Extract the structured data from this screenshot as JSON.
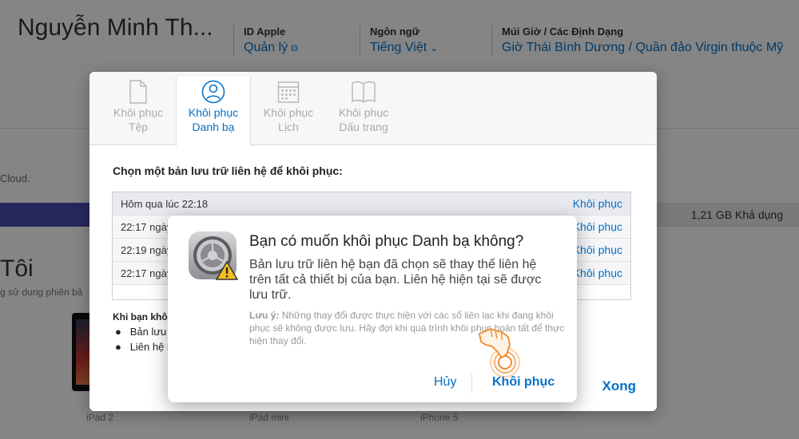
{
  "header": {
    "user_name": "Nguyễn Minh Th...",
    "apple_id": {
      "label": "ID Apple",
      "value": "Quản lý"
    },
    "language": {
      "label": "Ngôn ngữ",
      "value": "Tiếng Việt"
    },
    "timezone": {
      "label": "Múi Giờ / Các Định Dạng",
      "value": "Giờ Thái Bình Dương / Quần đảo Virgin thuộc Mỹ"
    }
  },
  "background": {
    "cloud_text": "Cloud.",
    "storage_available": "1,21 GB Khả dụng",
    "section_title": "Tôi",
    "section_subtitle": "g sử dụng phiên bả",
    "devices": [
      "iPad 2",
      "iPad mini",
      "iPhone 5"
    ]
  },
  "panel": {
    "tabs": [
      {
        "line1": "Khôi phục",
        "line2": "Tệp",
        "icon": "file-icon"
      },
      {
        "line1": "Khôi phục",
        "line2": "Danh bạ",
        "icon": "contacts-icon"
      },
      {
        "line1": "Khôi phục",
        "line2": "Lịch",
        "icon": "calendar-icon"
      },
      {
        "line1": "Khôi phục",
        "line2": "Dấu trang",
        "icon": "bookmarks-icon"
      }
    ],
    "heading": "Chọn một bản lưu trữ liên hệ để khôi phục:",
    "backups": [
      {
        "date": "Hôm qua lúc 22:18",
        "action": "Khôi phục"
      },
      {
        "date": "22:17 ngày",
        "action": "Khôi phục"
      },
      {
        "date": "22:19 ngày",
        "action": "Khôi phục"
      },
      {
        "date": "22:17 ngày",
        "action": "Khôi phục"
      }
    ],
    "note_title": "Khi bạn khô",
    "bullets": [
      "Bản lưu",
      "Liên hệ l"
    ],
    "done": "Xong"
  },
  "alert": {
    "title": "Bạn có muốn khôi phục Danh bạ không?",
    "message": "Bản lưu trữ liên hệ bạn đã chọn sẽ thay thế liên hệ trên tất cả thiết bị của bạn. Liên hệ hiện tại sẽ được lưu trữ.",
    "note_label": "Lưu ý:",
    "note": "Những thay đổi được thực hiện với các sổ liên lạc khi đang khôi phục sẽ không được lưu. Hãy đợi khi quá trình khôi phục hoàn tất để thực hiện thay đổi.",
    "cancel": "Hủy",
    "confirm": "Khôi phục"
  },
  "colors": {
    "accent": "#0070c9",
    "storage_bar": "#4b4bb5"
  }
}
